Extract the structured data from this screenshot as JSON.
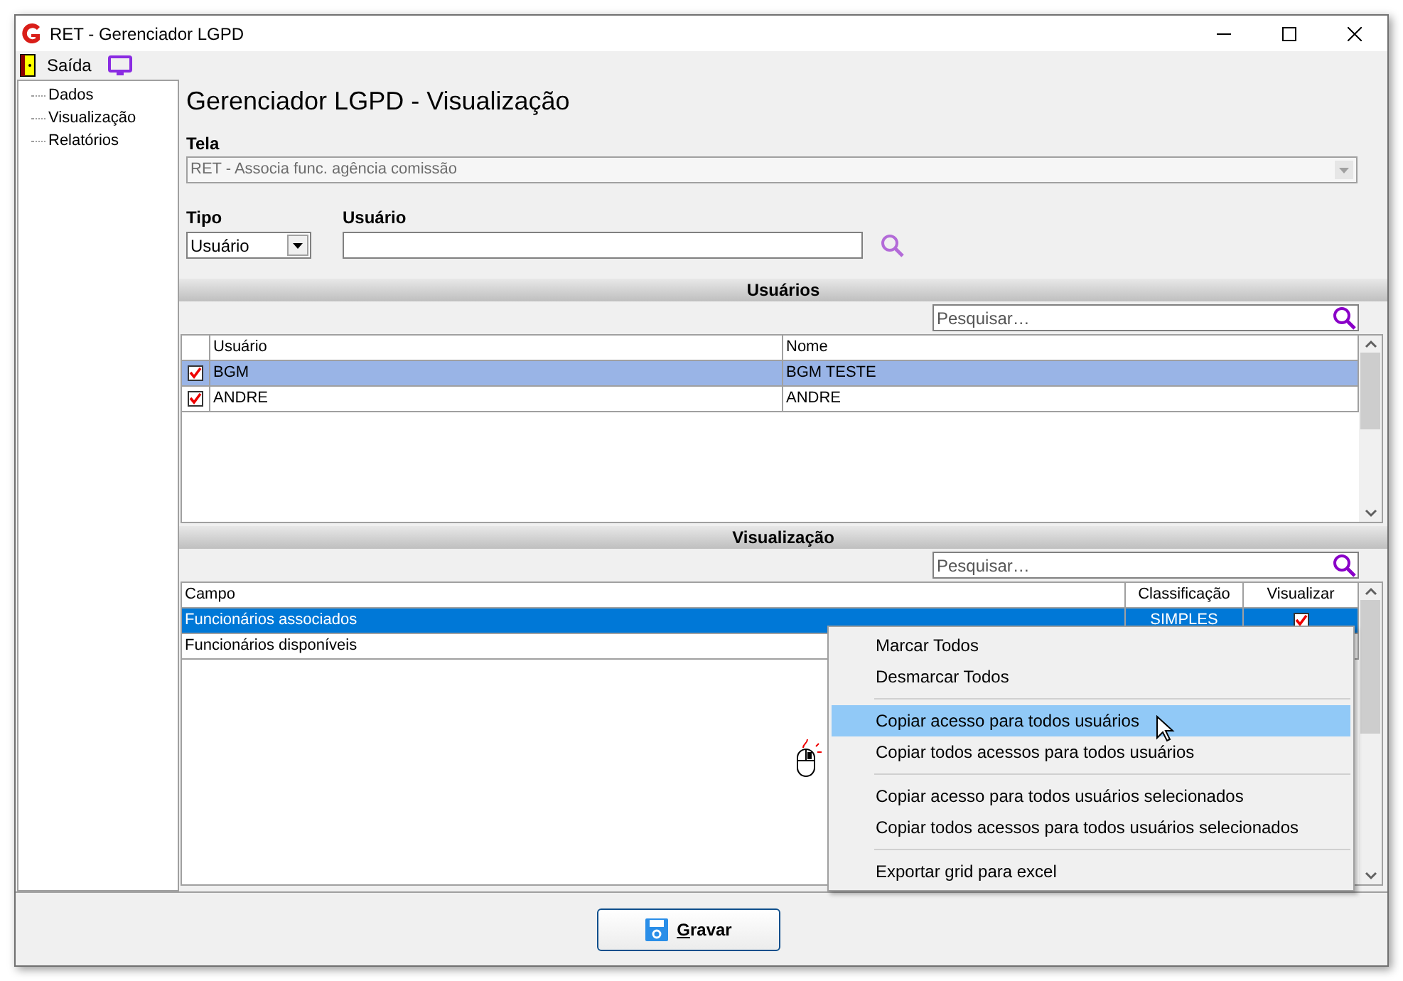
{
  "window": {
    "title": "RET - Gerenciador LGPD"
  },
  "menu": [
    {
      "label": "Saída"
    }
  ],
  "tree": [
    {
      "label": "Dados"
    },
    {
      "label": "Visualização"
    },
    {
      "label": "Relatórios"
    }
  ],
  "heading": "Gerenciador LGPD - Visualização",
  "tela": {
    "label": "Tela",
    "value": "RET - Associa func. agência comissão",
    "disabled": true
  },
  "tipo": {
    "label": "Tipo",
    "value": "Usuário"
  },
  "usuario": {
    "label": "Usuário"
  },
  "users_section": {
    "title": "Usuários",
    "search": {
      "placeholder": "Pesquisar…"
    },
    "columns": [
      "Usuário",
      "Nome"
    ],
    "rows": [
      {
        "checked": true,
        "selected": true,
        "cells": [
          "BGM",
          "BGM TESTE"
        ]
      },
      {
        "checked": true,
        "selected": false,
        "cells": [
          "ANDRE",
          "ANDRE"
        ]
      }
    ]
  },
  "view_section": {
    "title": "Visualização",
    "search": {
      "placeholder": "Pesquisar…"
    },
    "columns": [
      "Campo",
      "Classificação",
      "Visualizar"
    ],
    "rows": [
      {
        "selected": true,
        "cells": [
          "Funcionários associados",
          "SIMPLES"
        ],
        "visualizar": true
      },
      {
        "selected": false,
        "cells": [
          "Funcionários disponíveis"
        ]
      }
    ]
  },
  "context_menu": {
    "items": [
      {
        "kind": "item",
        "label": "Marcar Todos",
        "selected": false
      },
      {
        "kind": "item",
        "label": "Desmarcar Todos",
        "selected": false
      },
      {
        "kind": "separator"
      },
      {
        "kind": "item",
        "label": "Copiar acesso para todos usuários",
        "selected": true
      },
      {
        "kind": "item",
        "label": "Copiar todos acessos para todos usuários",
        "selected": false
      },
      {
        "kind": "separator"
      },
      {
        "kind": "item",
        "label": "Copiar acesso para todos usuários selecionados",
        "selected": false
      },
      {
        "kind": "item",
        "label": "Copiar todos acessos para todos usuários selecionados",
        "selected": false
      },
      {
        "kind": "separator"
      },
      {
        "kind": "item",
        "label": "Exportar grid para excel",
        "selected": false
      }
    ]
  },
  "save_button": {
    "label": "Gravar"
  }
}
